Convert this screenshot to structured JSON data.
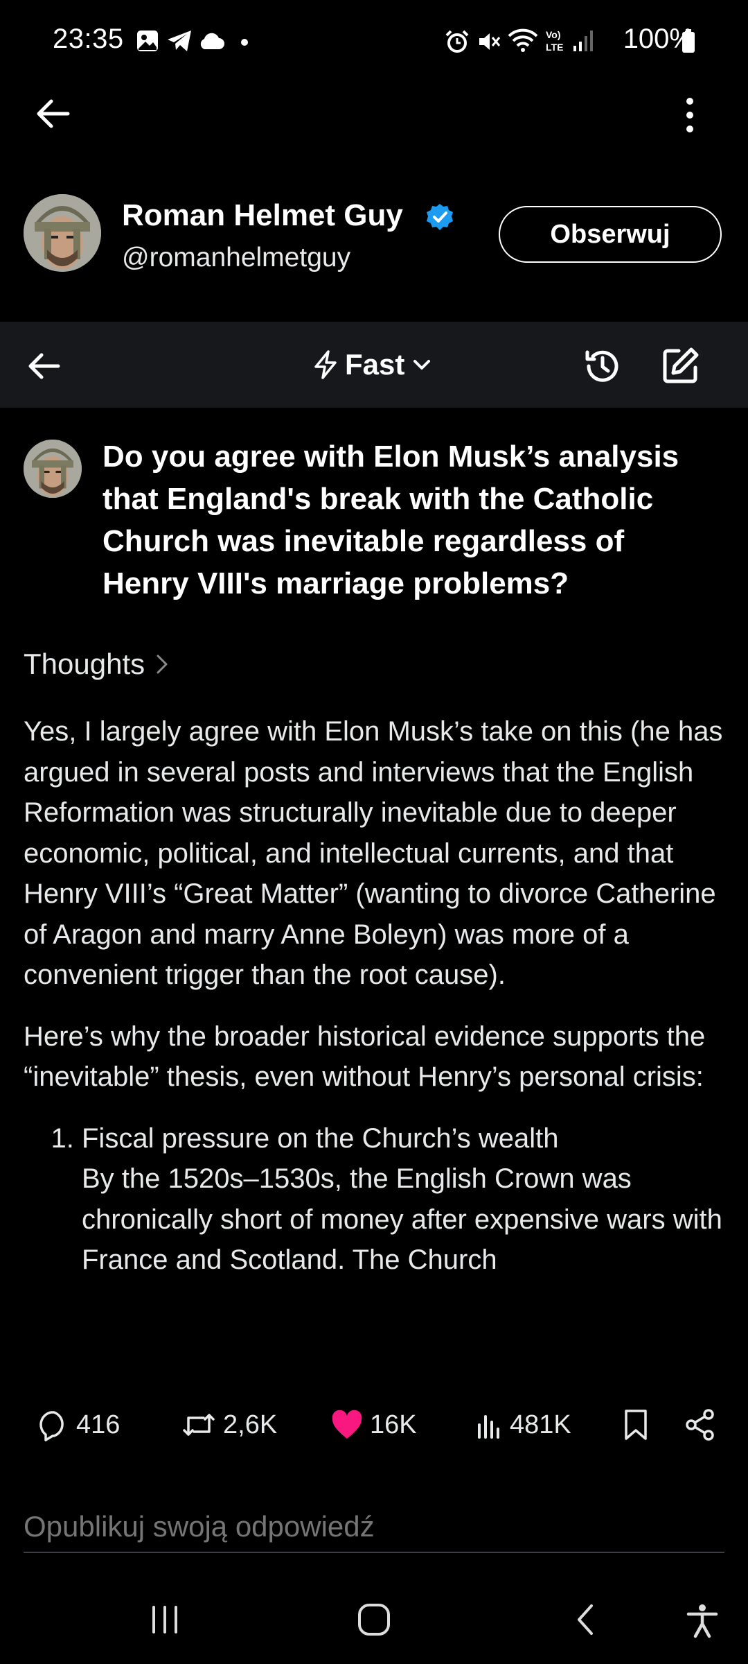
{
  "status_bar": {
    "time": "23:35",
    "battery": "100%"
  },
  "profile": {
    "name": "Roman Helmet Guy",
    "handle": "@romanhelmetguy",
    "follow_label": "Obserwuj",
    "verified_color": "#1d9bf0"
  },
  "grok_toolbar": {
    "mode_label": "Fast"
  },
  "question": "Do you agree with Elon Musk’s analysis that England's break with the Catholic Church was inevitable regardless of Henry VIII's marriage problems?",
  "thoughts_label": "Thoughts",
  "answer": {
    "paragraph_1": "Yes, I largely agree with Elon Musk’s take on this (he has argued in several posts and interviews that the English Reformation was structurally inevitable due to deeper economic, political, and intellectual currents, and that Henry VIII’s “Great Matter” (wanting to divorce Catherine of Aragon and marry Anne Boleyn) was more of a convenient trigger than the root cause).",
    "paragraph_2": "Here’s why the broader historical evidence supports the “inevitable” thesis, even without Henry’s personal crisis:",
    "list_items": [
      {
        "title": "Fiscal pressure on the Church’s wealth",
        "body": "By the 1520s–1530s, the English Crown was chronically short of money after expensive wars with France and Scotland. The Church"
      }
    ]
  },
  "engagement": {
    "replies": "416",
    "reposts": "2,6K",
    "likes": "16K",
    "views": "481K",
    "like_color": "#f91880"
  },
  "reply_placeholder": "Opublikuj swoją odpowiedź"
}
